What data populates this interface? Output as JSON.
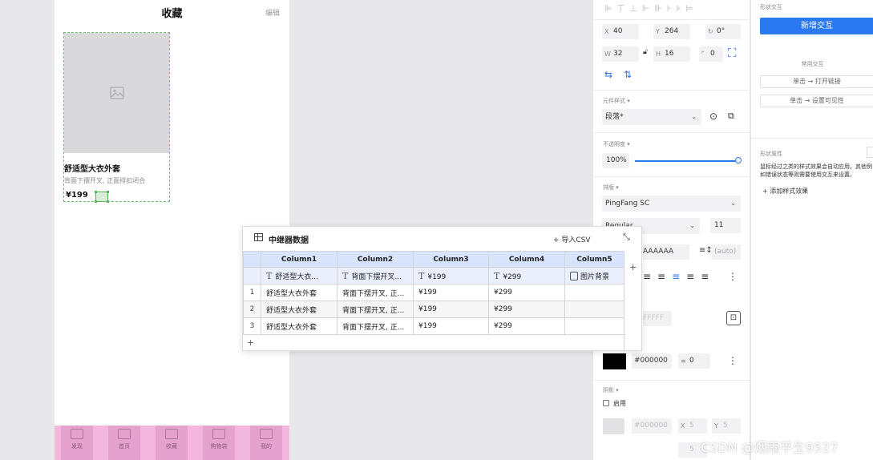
{
  "phone": {
    "title": "收藏",
    "edit_label": "编辑",
    "card": {
      "title": "舒适型大衣外套",
      "subtitle": "背面下摆开叉, 正面排扣闭合",
      "price": "¥199"
    },
    "tabs": [
      {
        "label": "发现",
        "icon": "home-icon"
      },
      {
        "label": "首页",
        "icon": "image-icon"
      },
      {
        "label": "收藏",
        "icon": "heart-icon"
      },
      {
        "label": "购物袋",
        "icon": "bag-icon"
      },
      {
        "label": "我的",
        "icon": "user-icon"
      }
    ]
  },
  "inspector": {
    "x_label": "X",
    "x_value": "40",
    "y_label": "Y",
    "y_value": "264",
    "rotation": "0°",
    "w_label": "W",
    "w_value": "32",
    "h_label": "H",
    "h_value": "16",
    "radius": "0",
    "component_style_label": "元件样式",
    "component_style_value": "段落*",
    "opacity_label": "不透明度",
    "opacity_value": "100%",
    "opacity_fraction": 1.0,
    "typography_label": "排版",
    "font_family": "PingFang SC",
    "font_weight": "Regular",
    "font_size": "11",
    "color_value": "AAAAAA",
    "line_height": "(auto)",
    "fill_value": "FFFFF",
    "border_color": "#000000",
    "border_width": "0",
    "shadow_label": "阴影",
    "shadow_enable": "启用",
    "shadow_color": "#000000",
    "shadow_x": "5",
    "shadow_y": "5",
    "shadow_blur": "5"
  },
  "interactions": {
    "header": "形状交互",
    "add_button": "新增交互",
    "common_label": "常用交互",
    "options": [
      "单击 → 打开链接",
      "单击 → 设置可见性"
    ],
    "props_label": "形状属性",
    "props_hint": "鼠标经过之类的样式效果会自动应用。其他例如错误状态等则需要使用交互来设置。",
    "add_style": "+ 添加样式效果"
  },
  "repeater": {
    "title": "中继器数据",
    "import_label": "+ 导入CSV",
    "columns": [
      "Column1",
      "Column2",
      "Column3",
      "Column4",
      "Column5"
    ],
    "column_types": [
      "舒适型大衣...",
      "背面下摆开叉...",
      "¥199",
      "¥299",
      "图片背景"
    ],
    "rows": [
      [
        "1",
        "舒适型大衣外套",
        "背面下摆开叉, 正...",
        "¥199",
        "¥299",
        ""
      ],
      [
        "2",
        "舒适型大衣外套",
        "背面下摆开叉, 正...",
        "¥199",
        "¥299",
        ""
      ],
      [
        "3",
        "舒适型大衣外套",
        "背面下摆开叉, 正...",
        "¥199",
        "¥299",
        ""
      ]
    ]
  },
  "watermark": "CSDN @烟雨平生9527"
}
